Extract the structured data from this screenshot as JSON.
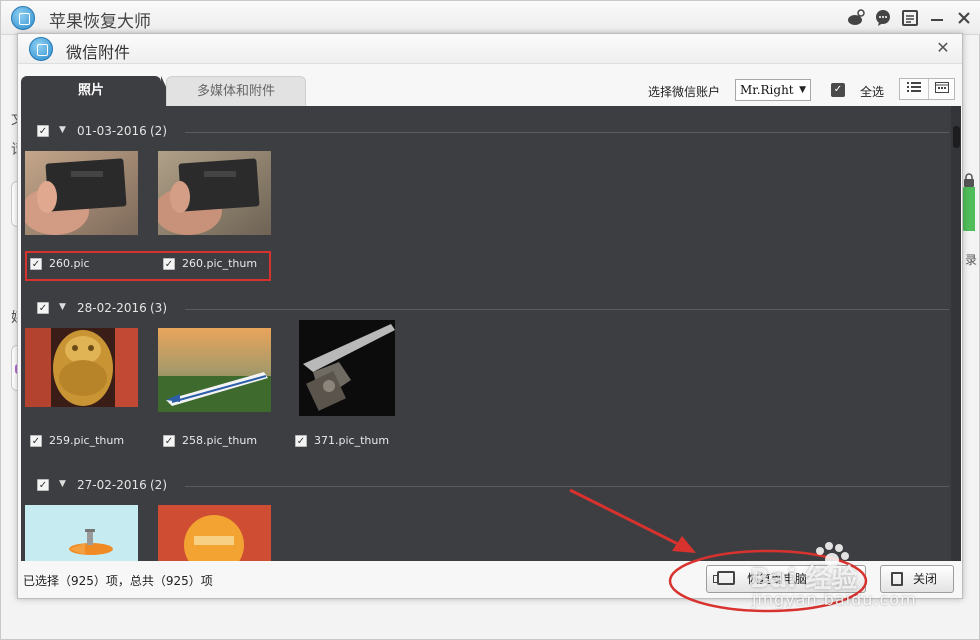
{
  "app": {
    "title": "苹果恢复大师",
    "controls": [
      "weibo-icon",
      "chat-icon",
      "menu-icon",
      "minimize-icon",
      "close-icon"
    ]
  },
  "background": {
    "chars": [
      "文",
      "请",
      "媒"
    ],
    "right_char": "录"
  },
  "dialog": {
    "title": "微信附件",
    "tabs": [
      {
        "label": "照片",
        "active": true
      },
      {
        "label": "多媒体和附件",
        "active": false
      }
    ],
    "account_label": "选择微信账户",
    "account_value": "Mr.Right",
    "select_all_label": "全选",
    "select_all_checked": true,
    "view_modes": [
      "list-view-icon",
      "calendar-view-icon"
    ]
  },
  "groups": [
    {
      "date": "01-03-2016",
      "count": "(2)",
      "checked": true,
      "items": [
        {
          "name": "260.pic",
          "checked": true
        },
        {
          "name": "260.pic_thum",
          "checked": true
        }
      ]
    },
    {
      "date": "28-02-2016",
      "count": "(3)",
      "checked": true,
      "items": [
        {
          "name": "259.pic_thum",
          "checked": true
        },
        {
          "name": "258.pic_thum",
          "checked": true
        },
        {
          "name": "371.pic_thum",
          "checked": true
        }
      ]
    },
    {
      "date": "27-02-2016",
      "count": "(2)",
      "checked": true,
      "items": [
        {
          "name": "",
          "checked": true
        },
        {
          "name": "",
          "checked": true
        }
      ]
    }
  ],
  "footer": {
    "status": "已选择（925）项，总共（925）项",
    "recover_button": "恢复到电脑",
    "close_button": "关闭"
  },
  "watermark": {
    "brand": "Bai 经验",
    "url": "jingyan.baidu.com"
  },
  "colors": {
    "panel_bg": "#3d3e42",
    "annotation_red": "#d8322e",
    "tab_active": "#3d3e42"
  }
}
